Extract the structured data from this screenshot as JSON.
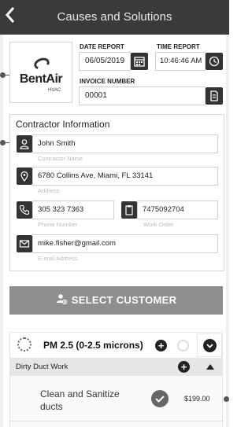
{
  "header": {
    "back_icon": "chevron-left-icon",
    "title": "Causes and Solutions"
  },
  "logo": {
    "brand": "BentAir",
    "sub": "HVAC"
  },
  "report": {
    "date_label": "DATE REPORT",
    "date_value": "06/05/2019",
    "time_label": "TIME REPORT",
    "time_value": "10:46:46 AM",
    "invoice_label": "INVOICE NUMBER",
    "invoice_value": "00001"
  },
  "contractor": {
    "section_title": "Contractor Information",
    "name_value": "John Smith",
    "name_hint": "Contractor Name",
    "address_value": "6780 Collins Ave, Miami, FL 33141",
    "address_hint": "Address",
    "phone_value": "305 323 7363",
    "phone_hint": "Phone Number",
    "work_order_value": "7475092704",
    "work_order_hint": "Work Order",
    "email_value": "mike.fisher@gmail.com",
    "email_hint": "E-mail Address"
  },
  "select_customer": {
    "label": "SELECT CUSTOMER",
    "icon": "add-user-icon"
  },
  "pm_section": {
    "title": "PM 2.5 (0-2.5 microns)",
    "add_symbol": "+"
  },
  "dirty_duct": {
    "title": "Dirty Duct Work",
    "add_symbol": "+"
  },
  "item": {
    "name": "Clean and Sanitize ducts",
    "price": "$199.00"
  },
  "colors": {
    "topbar": "#3a3a3a",
    "button_gray": "#8e8e8e",
    "icon_dark": "#333333"
  }
}
